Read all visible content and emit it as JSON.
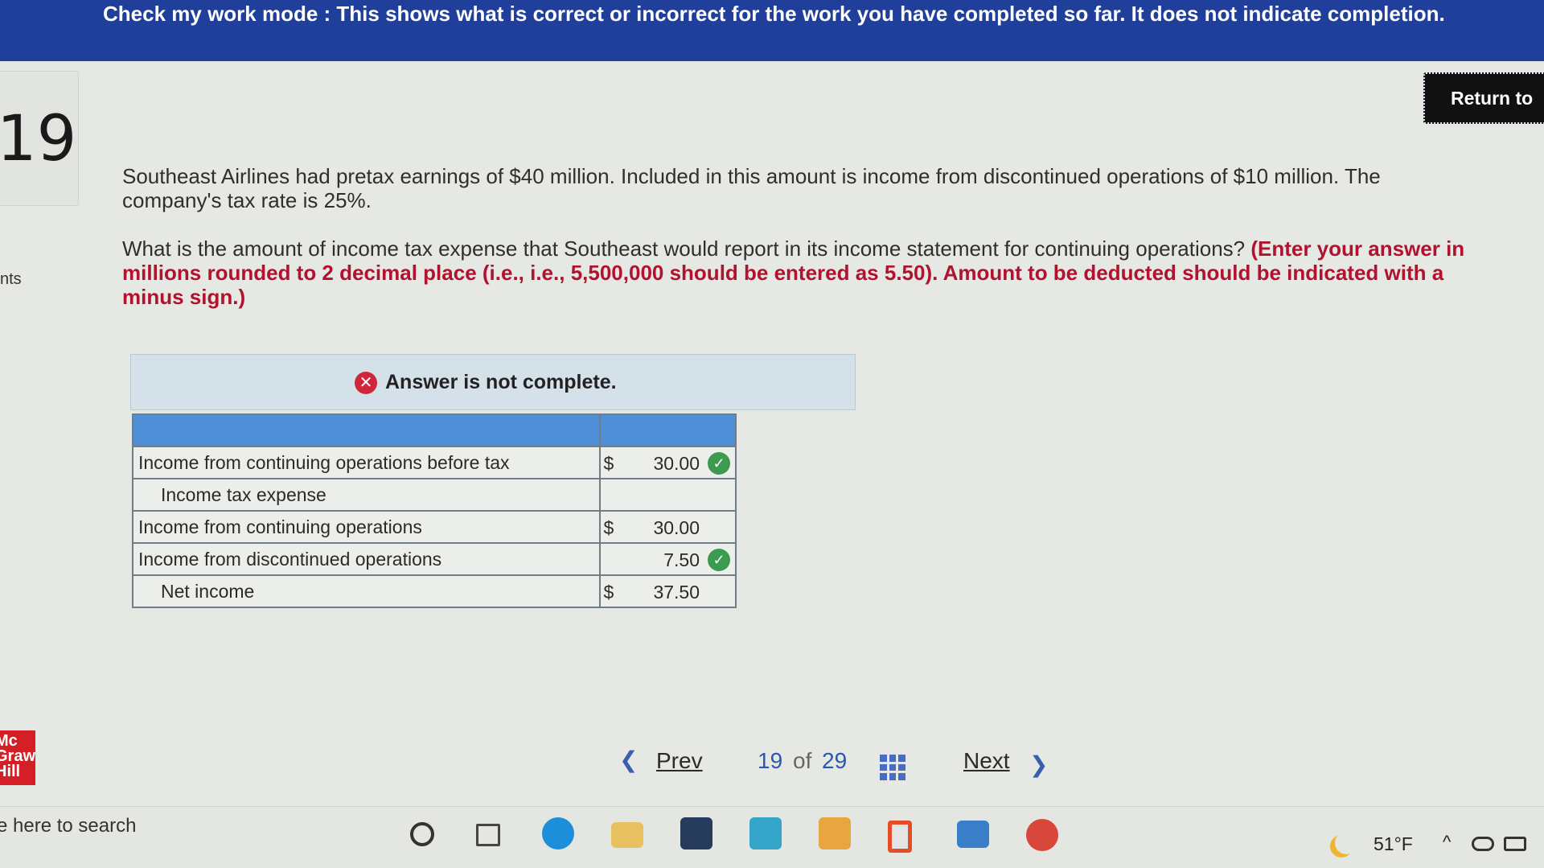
{
  "banner": {
    "text": "Check my work mode : This shows what is correct or incorrect for the work you have completed so far. It does not indicate completion."
  },
  "question_number": "19",
  "side_label": "nts",
  "return_button": "Return to",
  "question": {
    "paragraph1": "Southeast Airlines had pretax earnings of $40 million. Included in this amount is income from discontinued operations of $10 million. The company's tax rate is 25%.",
    "paragraph2_text": "What is the amount of income tax expense that Southeast would report in its income statement for continuing operations? ",
    "paragraph2_hint": "(Enter your answer in millions rounded to 2 decimal place (i.e., i.e., 5,500,000 should be entered as 5.50). Amount to be deducted should be indicated with a minus sign.)"
  },
  "status": {
    "text": "Answer is not complete.",
    "icon": "x-circle-icon",
    "color": "#d0263b"
  },
  "table": {
    "rows": [
      {
        "label": "Income from continuing operations before tax",
        "indent": false,
        "dollar": "$",
        "value": "30.00",
        "check": true
      },
      {
        "label": "Income tax expense",
        "indent": true,
        "dollar": "",
        "value": "",
        "check": false
      },
      {
        "label": "Income from continuing operations",
        "indent": false,
        "dollar": "$",
        "value": "30.00",
        "check": false
      },
      {
        "label": "Income from discontinued operations",
        "indent": false,
        "dollar": "",
        "value": "7.50",
        "check": true
      },
      {
        "label": "Net income",
        "indent": true,
        "dollar": "$",
        "value": "37.50",
        "check": false
      }
    ]
  },
  "logo": {
    "line1": "Mc",
    "line2": "Graw",
    "line3": "Hill"
  },
  "pagination": {
    "prev": "Prev",
    "current": "19",
    "of": "of",
    "total": "29",
    "next": "Next"
  },
  "taskbar": {
    "search_text": "e here to search",
    "temperature": "51°F"
  }
}
